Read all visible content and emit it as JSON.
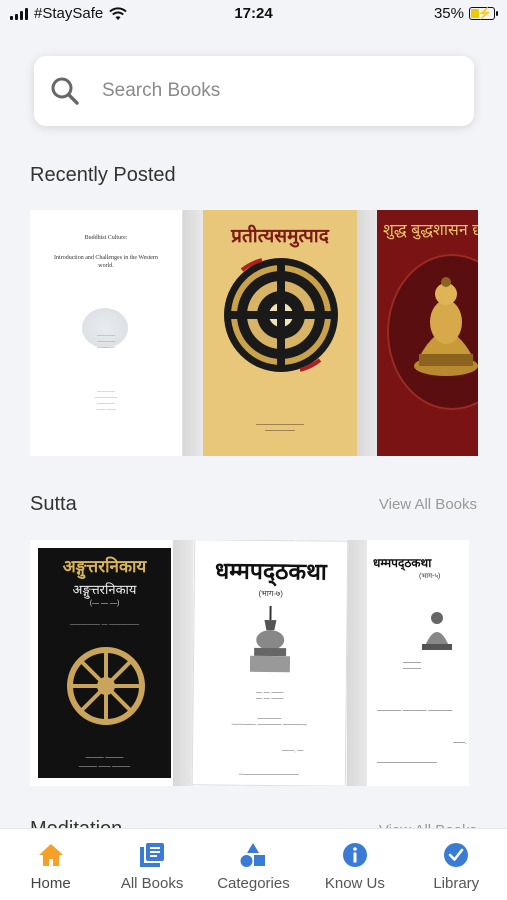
{
  "status_bar": {
    "carrier": "#StaySafe",
    "time": "17:24",
    "battery": "35%",
    "battery_level": 0.35
  },
  "search": {
    "placeholder": "Search Books",
    "icon": "search-icon"
  },
  "sections": [
    {
      "title": "Recently Posted",
      "view_all": "",
      "books": [
        {
          "cover_title": "Buddhist Culture:",
          "cover_lines": [
            "Introduction and Challenges in the Western",
            "world."
          ]
        },
        {
          "cover_title": "प्रतीत्यसमुत्पाद"
        },
        {
          "cover_title": "शुद्ध बुद्धशासन छगू"
        }
      ]
    },
    {
      "title": "Sutta",
      "view_all": "View All Books",
      "books": [
        {
          "cover_title": "अङ्गुत्तरनिकाय",
          "cover_subtitle": "अङ्गुत्तरनिकाय"
        },
        {
          "cover_title": "धम्मपद्ठकथा",
          "cover_subtitle": "(भाग-७)"
        },
        {
          "cover_title": "धम्मपद्ठकथा",
          "cover_subtitle": "(भाग-५)"
        }
      ]
    },
    {
      "title": "Meditation",
      "view_all": "View All Books"
    }
  ],
  "tabs": [
    {
      "label": "Home",
      "icon": "home-icon",
      "active": true
    },
    {
      "label": "All Books",
      "icon": "books-icon",
      "active": false
    },
    {
      "label": "Categories",
      "icon": "categories-icon",
      "active": false
    },
    {
      "label": "Know Us",
      "icon": "info-icon",
      "active": false
    },
    {
      "label": "Library",
      "icon": "library-icon",
      "active": false
    }
  ],
  "colors": {
    "background": "#f3f4f7",
    "active_tab": "#f5a028",
    "inactive_tab": "#3a7bd5"
  }
}
